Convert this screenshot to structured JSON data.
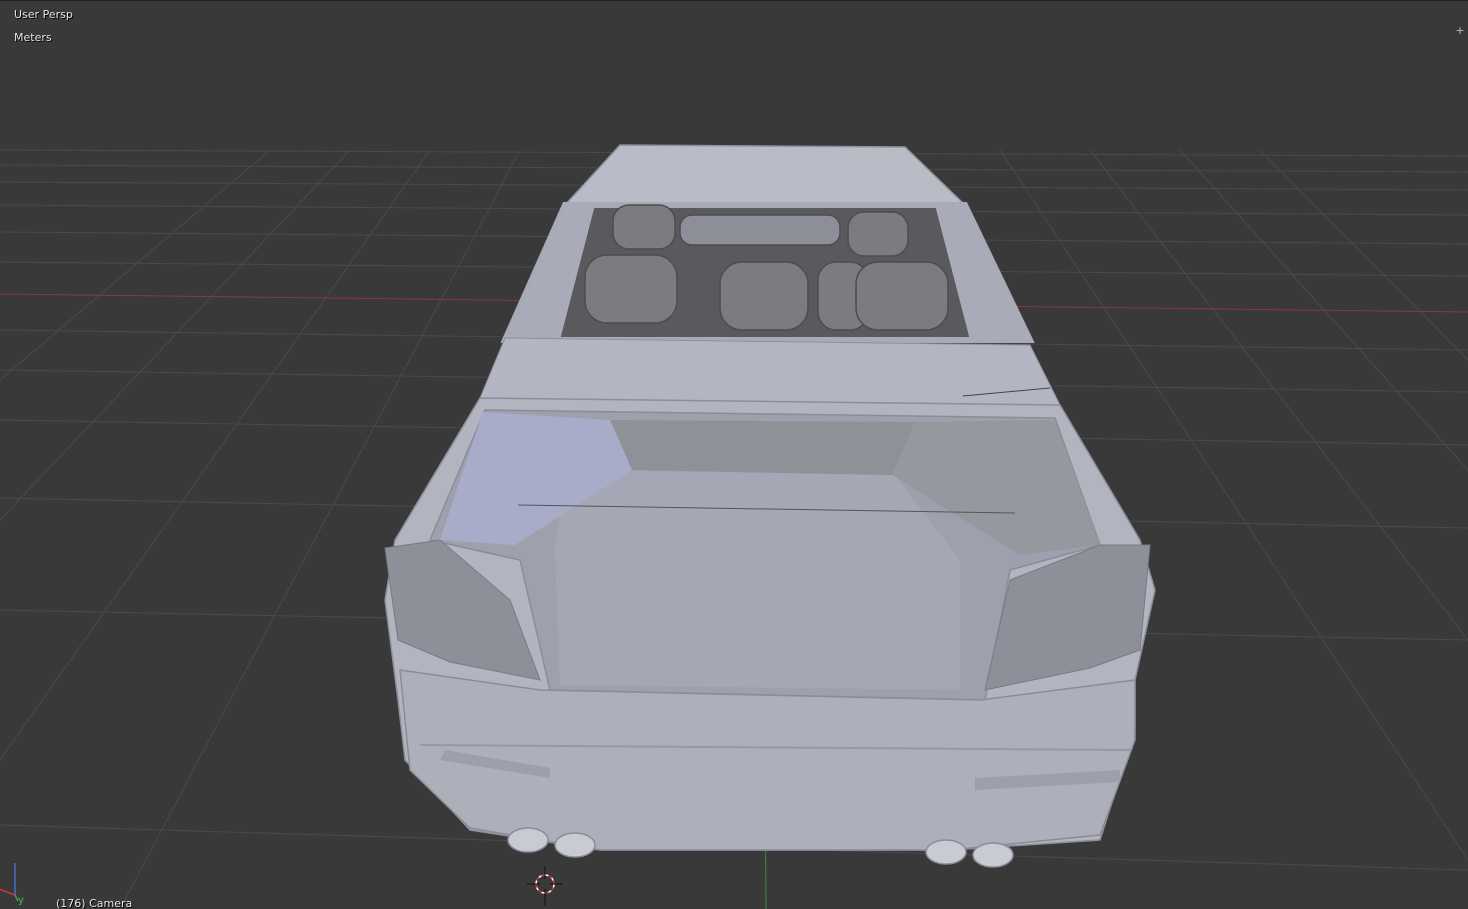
{
  "viewport": {
    "view_name": "User Persp",
    "units": "Meters",
    "frame_info": "(176) Camera",
    "axis_label_y": "y",
    "corner_widget": "+"
  },
  "colors": {
    "background": "#393939",
    "grid": "#4a4a4a",
    "x_axis": "#8a3a3a",
    "y_axis": "#3f8a3f",
    "model": "#b4b6c2",
    "overlay_text": "#e6e6e6",
    "cursor": "#d03030"
  },
  "icons": {
    "axis_gizmo": "axis-gizmo-icon",
    "cursor_3d": "3d-cursor-icon",
    "corner": "plus-icon"
  }
}
